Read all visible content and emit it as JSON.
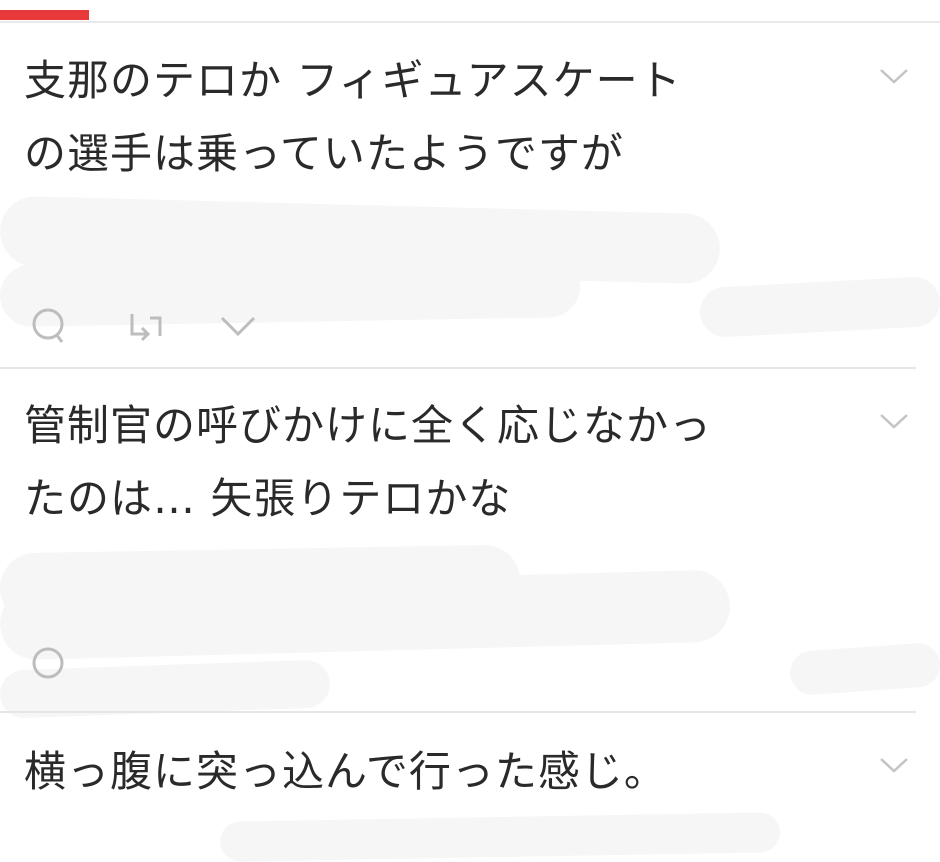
{
  "colors": {
    "accent": "#e8393a",
    "link": "#4a8fe0",
    "text": "#2a2a2a",
    "meta": "#9a9a9a"
  },
  "comments": [
    {
      "text_line1": "支那のテロか フィギュアスケート",
      "text_line2": "の選手は乗っていたようですが",
      "collapse_icon": "chevron-down-icon",
      "reply_icon": "reply-icon",
      "retweet_icon": "retweet-icon",
      "more_icon": "chevron-down-icon"
    },
    {
      "text_line1": "管制官の呼びかけに全く応じなかっ",
      "text_line2": "たのは… 矢張りテロかな",
      "collapse_icon": "chevron-down-icon",
      "reply_icon": "reply-icon"
    },
    {
      "text_line1": "横っ腹に突っ込んで行った感じ。",
      "collapse_icon": "chevron-down-icon"
    }
  ]
}
